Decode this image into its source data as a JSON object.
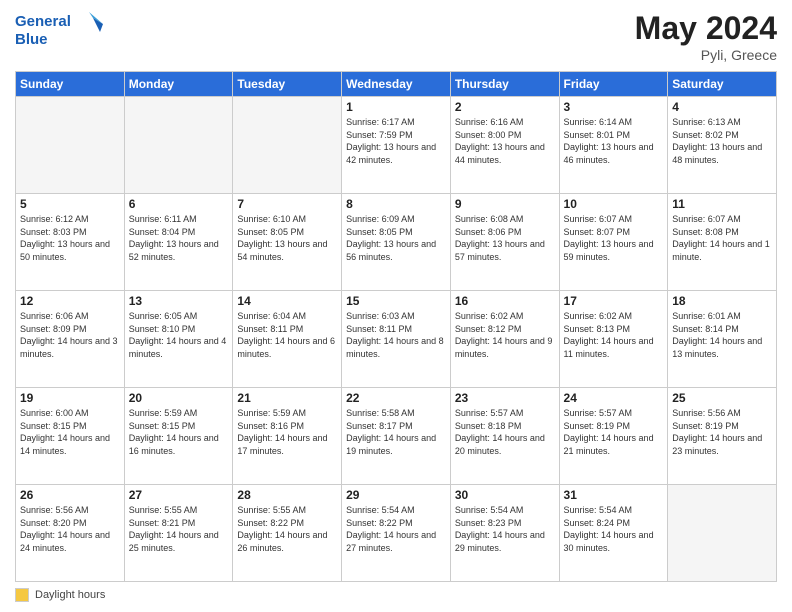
{
  "header": {
    "logo_line1": "General",
    "logo_line2": "Blue",
    "month_year": "May 2024",
    "location": "Pyli, Greece"
  },
  "footer": {
    "legend_label": "Daylight hours"
  },
  "weekdays": [
    "Sunday",
    "Monday",
    "Tuesday",
    "Wednesday",
    "Thursday",
    "Friday",
    "Saturday"
  ],
  "weeks": [
    [
      {
        "day": "",
        "sunrise": "",
        "sunset": "",
        "daylight": ""
      },
      {
        "day": "",
        "sunrise": "",
        "sunset": "",
        "daylight": ""
      },
      {
        "day": "",
        "sunrise": "",
        "sunset": "",
        "daylight": ""
      },
      {
        "day": "1",
        "sunrise": "Sunrise: 6:17 AM",
        "sunset": "Sunset: 7:59 PM",
        "daylight": "Daylight: 13 hours and 42 minutes."
      },
      {
        "day": "2",
        "sunrise": "Sunrise: 6:16 AM",
        "sunset": "Sunset: 8:00 PM",
        "daylight": "Daylight: 13 hours and 44 minutes."
      },
      {
        "day": "3",
        "sunrise": "Sunrise: 6:14 AM",
        "sunset": "Sunset: 8:01 PM",
        "daylight": "Daylight: 13 hours and 46 minutes."
      },
      {
        "day": "4",
        "sunrise": "Sunrise: 6:13 AM",
        "sunset": "Sunset: 8:02 PM",
        "daylight": "Daylight: 13 hours and 48 minutes."
      }
    ],
    [
      {
        "day": "5",
        "sunrise": "Sunrise: 6:12 AM",
        "sunset": "Sunset: 8:03 PM",
        "daylight": "Daylight: 13 hours and 50 minutes."
      },
      {
        "day": "6",
        "sunrise": "Sunrise: 6:11 AM",
        "sunset": "Sunset: 8:04 PM",
        "daylight": "Daylight: 13 hours and 52 minutes."
      },
      {
        "day": "7",
        "sunrise": "Sunrise: 6:10 AM",
        "sunset": "Sunset: 8:05 PM",
        "daylight": "Daylight: 13 hours and 54 minutes."
      },
      {
        "day": "8",
        "sunrise": "Sunrise: 6:09 AM",
        "sunset": "Sunset: 8:05 PM",
        "daylight": "Daylight: 13 hours and 56 minutes."
      },
      {
        "day": "9",
        "sunrise": "Sunrise: 6:08 AM",
        "sunset": "Sunset: 8:06 PM",
        "daylight": "Daylight: 13 hours and 57 minutes."
      },
      {
        "day": "10",
        "sunrise": "Sunrise: 6:07 AM",
        "sunset": "Sunset: 8:07 PM",
        "daylight": "Daylight: 13 hours and 59 minutes."
      },
      {
        "day": "11",
        "sunrise": "Sunrise: 6:07 AM",
        "sunset": "Sunset: 8:08 PM",
        "daylight": "Daylight: 14 hours and 1 minute."
      }
    ],
    [
      {
        "day": "12",
        "sunrise": "Sunrise: 6:06 AM",
        "sunset": "Sunset: 8:09 PM",
        "daylight": "Daylight: 14 hours and 3 minutes."
      },
      {
        "day": "13",
        "sunrise": "Sunrise: 6:05 AM",
        "sunset": "Sunset: 8:10 PM",
        "daylight": "Daylight: 14 hours and 4 minutes."
      },
      {
        "day": "14",
        "sunrise": "Sunrise: 6:04 AM",
        "sunset": "Sunset: 8:11 PM",
        "daylight": "Daylight: 14 hours and 6 minutes."
      },
      {
        "day": "15",
        "sunrise": "Sunrise: 6:03 AM",
        "sunset": "Sunset: 8:11 PM",
        "daylight": "Daylight: 14 hours and 8 minutes."
      },
      {
        "day": "16",
        "sunrise": "Sunrise: 6:02 AM",
        "sunset": "Sunset: 8:12 PM",
        "daylight": "Daylight: 14 hours and 9 minutes."
      },
      {
        "day": "17",
        "sunrise": "Sunrise: 6:02 AM",
        "sunset": "Sunset: 8:13 PM",
        "daylight": "Daylight: 14 hours and 11 minutes."
      },
      {
        "day": "18",
        "sunrise": "Sunrise: 6:01 AM",
        "sunset": "Sunset: 8:14 PM",
        "daylight": "Daylight: 14 hours and 13 minutes."
      }
    ],
    [
      {
        "day": "19",
        "sunrise": "Sunrise: 6:00 AM",
        "sunset": "Sunset: 8:15 PM",
        "daylight": "Daylight: 14 hours and 14 minutes."
      },
      {
        "day": "20",
        "sunrise": "Sunrise: 5:59 AM",
        "sunset": "Sunset: 8:15 PM",
        "daylight": "Daylight: 14 hours and 16 minutes."
      },
      {
        "day": "21",
        "sunrise": "Sunrise: 5:59 AM",
        "sunset": "Sunset: 8:16 PM",
        "daylight": "Daylight: 14 hours and 17 minutes."
      },
      {
        "day": "22",
        "sunrise": "Sunrise: 5:58 AM",
        "sunset": "Sunset: 8:17 PM",
        "daylight": "Daylight: 14 hours and 19 minutes."
      },
      {
        "day": "23",
        "sunrise": "Sunrise: 5:57 AM",
        "sunset": "Sunset: 8:18 PM",
        "daylight": "Daylight: 14 hours and 20 minutes."
      },
      {
        "day": "24",
        "sunrise": "Sunrise: 5:57 AM",
        "sunset": "Sunset: 8:19 PM",
        "daylight": "Daylight: 14 hours and 21 minutes."
      },
      {
        "day": "25",
        "sunrise": "Sunrise: 5:56 AM",
        "sunset": "Sunset: 8:19 PM",
        "daylight": "Daylight: 14 hours and 23 minutes."
      }
    ],
    [
      {
        "day": "26",
        "sunrise": "Sunrise: 5:56 AM",
        "sunset": "Sunset: 8:20 PM",
        "daylight": "Daylight: 14 hours and 24 minutes."
      },
      {
        "day": "27",
        "sunrise": "Sunrise: 5:55 AM",
        "sunset": "Sunset: 8:21 PM",
        "daylight": "Daylight: 14 hours and 25 minutes."
      },
      {
        "day": "28",
        "sunrise": "Sunrise: 5:55 AM",
        "sunset": "Sunset: 8:22 PM",
        "daylight": "Daylight: 14 hours and 26 minutes."
      },
      {
        "day": "29",
        "sunrise": "Sunrise: 5:54 AM",
        "sunset": "Sunset: 8:22 PM",
        "daylight": "Daylight: 14 hours and 27 minutes."
      },
      {
        "day": "30",
        "sunrise": "Sunrise: 5:54 AM",
        "sunset": "Sunset: 8:23 PM",
        "daylight": "Daylight: 14 hours and 29 minutes."
      },
      {
        "day": "31",
        "sunrise": "Sunrise: 5:54 AM",
        "sunset": "Sunset: 8:24 PM",
        "daylight": "Daylight: 14 hours and 30 minutes."
      },
      {
        "day": "",
        "sunrise": "",
        "sunset": "",
        "daylight": ""
      }
    ]
  ]
}
